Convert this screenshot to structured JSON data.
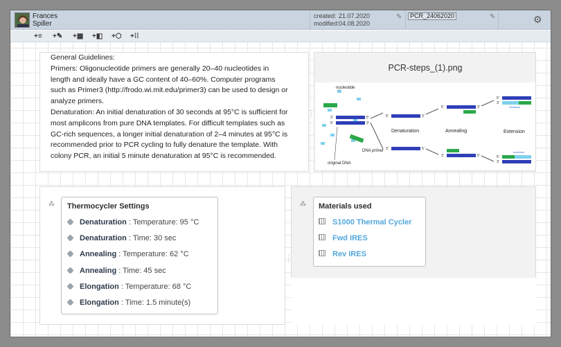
{
  "header": {
    "user_first": "Frances",
    "user_last": "Spiller",
    "created_label": "created:",
    "created_value": "21.07.2020",
    "modified_label": "modified:",
    "modified_value": "04.08.2020",
    "title_value": "PCR_24062020",
    "settings_icon": "gear-icon"
  },
  "toolbar": {
    "items": [
      "+≡",
      "+✎",
      "+▦",
      "+◧",
      "+⬡",
      "+⁞⁞"
    ]
  },
  "guidelines": {
    "lines": [
      "General Guidelines:",
      "Primers: Oligonucleotide primers are generally 20–40 nucleotides in",
      "length and ideally have a GC content of 40–60%. Computer programs",
      "such as Primer3 (http://frodo.wi.mit.edu/primer3) can be used to design or",
      "analyze primers.",
      "Denaturation: An initial denaturation of 30 seconds at 95°C is sufficient for",
      "most amplicons from pure DNA templates. For difficult templates such as",
      "GC-rich sequences, a longer initial denaturation of 2–4 minutes at 95°C is",
      "recommended prior to PCR cycling to fully denature the template. With",
      "colony PCR, an initial 5 minute denaturation at 95°C is recommended."
    ]
  },
  "image": {
    "filename": "PCR-steps_(1).png",
    "labels": {
      "nucleotide": "nucleotide",
      "dna_primer": "DNA primer",
      "original_dna": "original DNA",
      "denaturation": "Denaturation",
      "annealing": "Annealing",
      "extension": "Extension",
      "five": "5'",
      "three": "3'"
    }
  },
  "thermocycler": {
    "title": "Thermocycler Settings",
    "rows": [
      {
        "step": "Denaturation",
        "detail": " : Temperature: 95 °C"
      },
      {
        "step": "Denaturation",
        "detail": " : Time: 30 sec"
      },
      {
        "step": "Annealing",
        "detail": " : Temperature: 62 °C"
      },
      {
        "step": "Annealing",
        "detail": " : Time: 45 sec"
      },
      {
        "step": "Elongation",
        "detail": " : Temperature: 68 °C"
      },
      {
        "step": "Elongation",
        "detail": " : Time: 1.5 minute(s)"
      }
    ]
  },
  "materials": {
    "title": "Materials used",
    "items": [
      "S1000 Thermal Cycler",
      "Fwd IRES",
      "Rev IRES"
    ]
  },
  "colors": {
    "link": "#53a7dc",
    "strand_blue": "#2f3fb8",
    "primer_green": "#2aa84a",
    "nucleotide_cyan": "#7fd0ec"
  }
}
